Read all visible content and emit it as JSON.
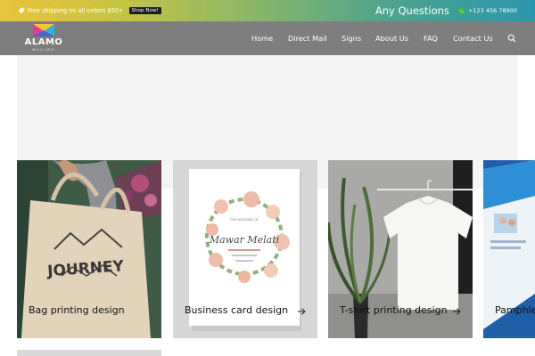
{
  "promo": {
    "text": "Free shipping on all orders $50+",
    "shop_button": "Shop Now!",
    "questions": "Any Questions",
    "phone": "+123 456 78900"
  },
  "logo": {
    "name": "ALAMO",
    "sub": "MAILING"
  },
  "nav": {
    "items": [
      {
        "label": "Home"
      },
      {
        "label": "Direct Mail"
      },
      {
        "label": "Signs"
      },
      {
        "label": "About Us"
      },
      {
        "label": "FAQ"
      },
      {
        "label": "Contact Us"
      }
    ]
  },
  "cards": [
    {
      "label": "Bag printing design",
      "image_text": "JOURNEY"
    },
    {
      "label": "Business card design",
      "image_text": "Mawar Melati",
      "image_small": "THE WEDDING OF"
    },
    {
      "label": "T-shirt printing design"
    },
    {
      "label": "Pamphlet"
    }
  ],
  "colors": {
    "promo_gradient_start": "#e9c43a",
    "promo_gradient_end": "#2a96ad",
    "nav_bg": "#7e7e7e",
    "hero_bg": "#f4f4f4"
  },
  "icons": [
    "tag-icon",
    "whatsapp-icon",
    "search-icon",
    "arrow-right-icon"
  ]
}
